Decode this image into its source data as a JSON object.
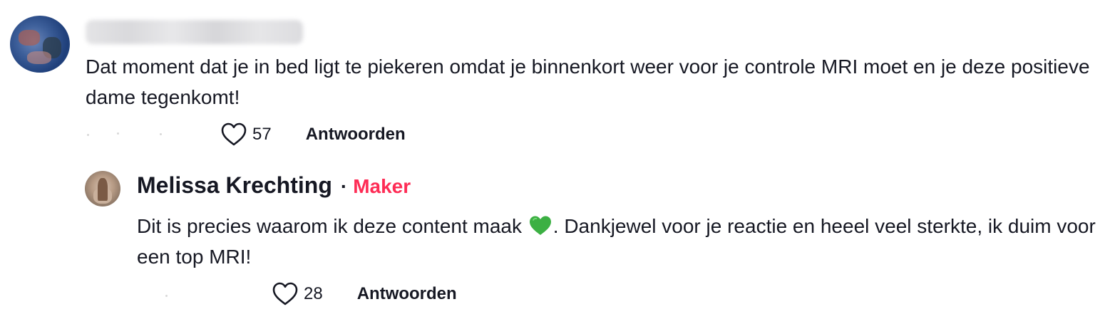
{
  "comment": {
    "text": "Dat moment dat je in bed ligt te piekeren omdat je binnenkort weer voor je controle MRI moet en je deze positieve dame tegenkomt!",
    "likes": "57",
    "reply_label": "Antwoorden"
  },
  "reply": {
    "author": "Melissa Krechting",
    "separator": "·",
    "badge": "Maker",
    "text_before_emoji": "Dit is precies waarom ik deze content maak",
    "emoji": "green-heart-icon",
    "text_after_emoji": ". Dankjewel voor je reactie en heeel veel sterkte, ik duim voor een top MRI!",
    "likes": "28",
    "reply_label": "Antwoorden"
  },
  "colors": {
    "badge": "#fe2c55",
    "text": "#161823",
    "emoji_heart": "#3cb043"
  }
}
